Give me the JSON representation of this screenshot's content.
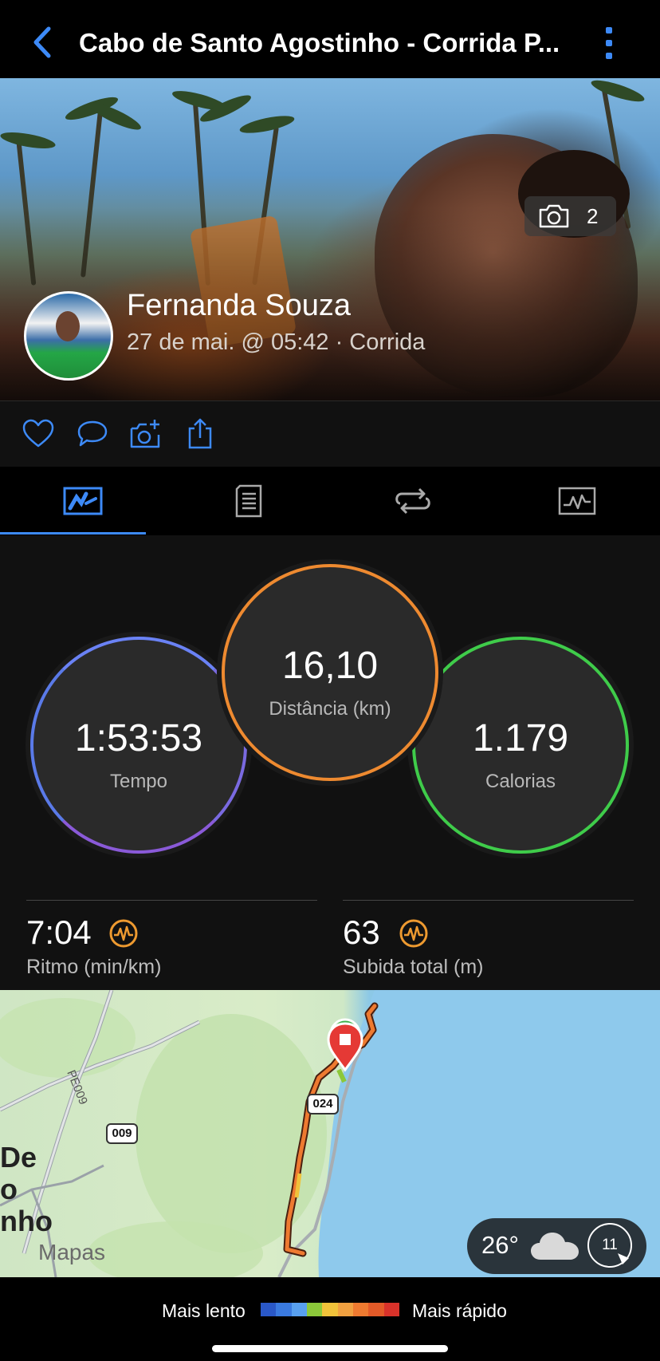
{
  "header": {
    "title": "Cabo de Santo Agostinho - Corrida P...",
    "back_icon": "chevron-left-icon",
    "menu_icon": "more-vertical-icon",
    "accent": "#3d8af7"
  },
  "hero": {
    "photo_count": "2",
    "user_name": "Fernanda Souza",
    "meta": "27 de mai. @ 05:42 · Corrida"
  },
  "actions": [
    "heart-icon",
    "comment-icon",
    "add-photo-icon",
    "share-icon"
  ],
  "tabs": [
    {
      "name": "overview",
      "icon": "summary-icon",
      "selected": true
    },
    {
      "name": "details",
      "icon": "document-icon",
      "selected": false
    },
    {
      "name": "laps",
      "icon": "laps-icon",
      "selected": false
    },
    {
      "name": "charts",
      "icon": "chart-icon",
      "selected": false
    }
  ],
  "stats": {
    "time": {
      "value": "1:53:53",
      "label": "Tempo",
      "color": "#6a7cf0"
    },
    "distance": {
      "value": "16,10",
      "label": "Distância (km)",
      "color": "#ee8a30"
    },
    "calories": {
      "value": "1.179",
      "label": "Calorias",
      "color": "#3fcc4a"
    },
    "pace": {
      "value": "7:04",
      "label": "Ritmo (min/km)"
    },
    "ascent": {
      "value": "63",
      "label": "Subida total (m)"
    }
  },
  "map": {
    "attribution": "Mapas",
    "road_labels": [
      "PE009",
      "009",
      "024"
    ],
    "town_label_fragments": [
      "De",
      "o",
      "nho"
    ],
    "weather": {
      "temp": "26°",
      "condition_icon": "cloud-icon",
      "wind": "11"
    }
  },
  "legend": {
    "slow": "Mais lento",
    "fast": "Mais rápido",
    "colors": [
      "#2a58c8",
      "#3a7ae0",
      "#58a0f0",
      "#8cc83a",
      "#f0c23a",
      "#f0a040",
      "#ee7a30",
      "#e35a28",
      "#d8322a"
    ]
  }
}
